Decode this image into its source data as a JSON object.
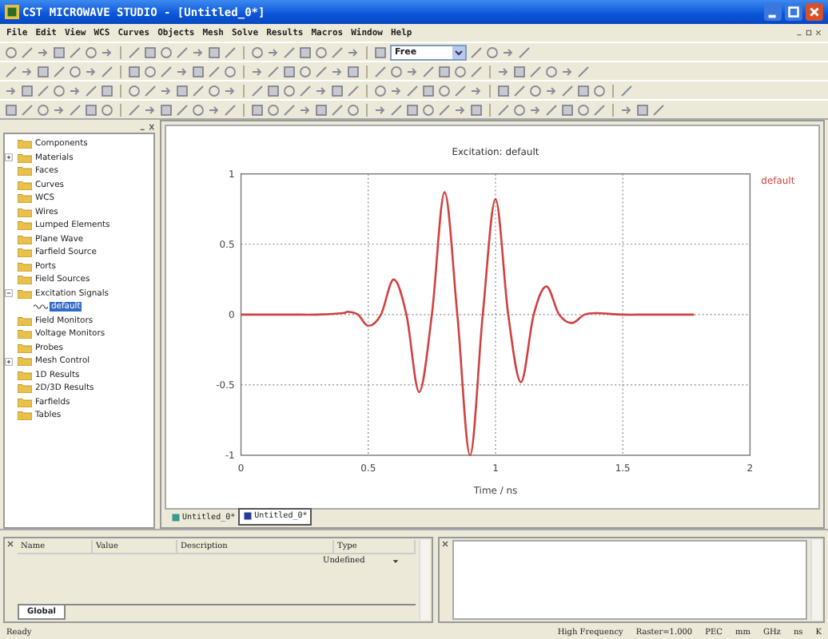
{
  "window": {
    "title": "CST MICROWAVE STUDIO - [Untitled_0*]"
  },
  "menu": [
    "File",
    "Edit",
    "View",
    "WCS",
    "Curves",
    "Objects",
    "Mesh",
    "Solve",
    "Results",
    "Macros",
    "Window",
    "Help"
  ],
  "toolbar": {
    "mode_select": {
      "value": "Free"
    }
  },
  "tree": [
    {
      "label": "Components",
      "selected": false
    },
    {
      "label": "Materials",
      "selected": false,
      "expanded": false
    },
    {
      "label": "Faces",
      "selected": false
    },
    {
      "label": "Curves",
      "selected": false
    },
    {
      "label": "WCS",
      "selected": false
    },
    {
      "label": "Wires",
      "selected": false
    },
    {
      "label": "Lumped Elements",
      "selected": false
    },
    {
      "label": "Plane Wave",
      "selected": false
    },
    {
      "label": "Farfield Source",
      "selected": false
    },
    {
      "label": "Ports",
      "selected": false
    },
    {
      "label": "Field Sources",
      "selected": false
    },
    {
      "label": "Excitation Signals",
      "selected": false,
      "expanded": true,
      "children": [
        {
          "label": "default",
          "selected": true
        }
      ]
    },
    {
      "label": "Field Monitors",
      "selected": false
    },
    {
      "label": "Voltage Monitors",
      "selected": false
    },
    {
      "label": "Probes",
      "selected": false
    },
    {
      "label": "Mesh Control",
      "selected": false,
      "expanded": false
    },
    {
      "label": "1D Results",
      "selected": false
    },
    {
      "label": "2D/3D Results",
      "selected": false
    },
    {
      "label": "Farfields",
      "selected": false
    },
    {
      "label": "Tables",
      "selected": false
    }
  ],
  "plot": {
    "chart_data": {
      "type": "line",
      "title": "Excitation: default",
      "xlabel": "Time / ns",
      "x": [
        0,
        0.1,
        0.2,
        0.3,
        0.4,
        0.42,
        0.46,
        0.5,
        0.55,
        0.6,
        0.65,
        0.7,
        0.75,
        0.8,
        0.85,
        0.9,
        0.95,
        1.0,
        1.05,
        1.1,
        1.15,
        1.2,
        1.25,
        1.3,
        1.35,
        1.4,
        1.5,
        1.6,
        1.7,
        1.78
      ],
      "series": [
        {
          "name": "default",
          "color": "#d04040",
          "values": [
            0,
            0,
            0,
            0,
            0.01,
            0.02,
            0,
            -0.08,
            0,
            0.25,
            0,
            -0.55,
            0,
            0.87,
            0,
            -1,
            0,
            0.82,
            0,
            -0.48,
            0,
            0.2,
            0,
            -0.06,
            0,
            0.01,
            0,
            0,
            0,
            0
          ]
        }
      ],
      "xlim": [
        0,
        2
      ],
      "ylim": [
        -1,
        1
      ],
      "grid": true,
      "xticks": [
        0,
        0.5,
        1,
        1.5,
        2
      ],
      "yticks": [
        1,
        0.5,
        0,
        -0.5,
        -1
      ]
    }
  },
  "document_tabs": [
    {
      "label": "Untitled_0*",
      "selected": false
    },
    {
      "label": "Untitled_0*",
      "selected": true
    }
  ],
  "parameters": {
    "columns": [
      "Name",
      "Value",
      "Description",
      "Type"
    ],
    "rows": [
      {
        "type": "Undefined"
      }
    ],
    "tabs": [
      {
        "label": "Global",
        "selected": true
      }
    ]
  },
  "status_bar": [
    "Ready",
    "High Frequency",
    "Raster=1.000",
    "PEC",
    "mm",
    "GHz",
    "ns",
    "K"
  ]
}
